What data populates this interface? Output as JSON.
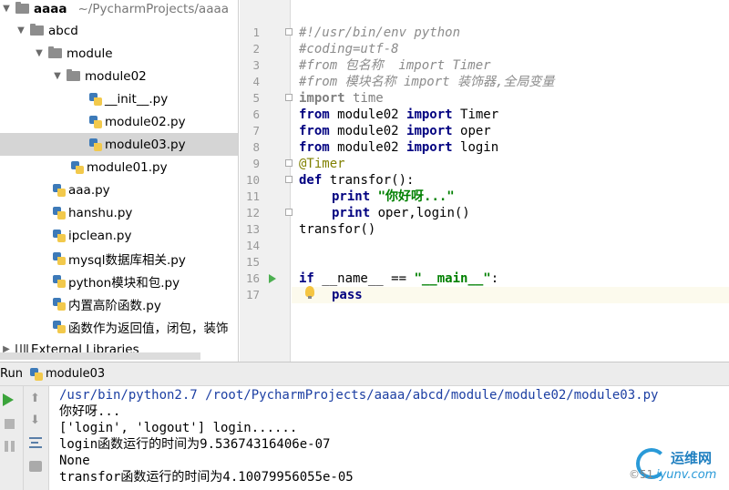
{
  "project_tree": {
    "root": {
      "name": "aaaa",
      "path": "~/PycharmProjects/aaaa"
    },
    "items": [
      {
        "label": "abcd",
        "type": "folder"
      },
      {
        "label": "module",
        "type": "folder"
      },
      {
        "label": "module02",
        "type": "folder"
      },
      {
        "label": "__init__.py",
        "type": "python-file"
      },
      {
        "label": "module02.py",
        "type": "python-file"
      },
      {
        "label": "module03.py",
        "type": "python-file"
      },
      {
        "label": "module01.py",
        "type": "python-file"
      },
      {
        "label": "aaa.py",
        "type": "python-file"
      },
      {
        "label": "hanshu.py",
        "type": "python-file"
      },
      {
        "label": "ipclean.py",
        "type": "python-file"
      },
      {
        "label": "mysql数据库相关.py",
        "type": "python-file"
      },
      {
        "label": "python模块和包.py",
        "type": "python-file"
      },
      {
        "label": "内置高阶函数.py",
        "type": "python-file"
      },
      {
        "label": "函数作为返回值，闭包，装饰",
        "type": "python-file"
      },
      {
        "label": "External Libraries",
        "type": "library"
      }
    ],
    "selected": "module03.py"
  },
  "editor": {
    "line_numbers": [
      "1",
      "2",
      "3",
      "4",
      "5",
      "6",
      "7",
      "8",
      "9",
      "10",
      "11",
      "12",
      "13",
      "14",
      "15",
      "16",
      "17"
    ],
    "line1": "#!/usr/bin/env python",
    "line2": "#coding=utf-8",
    "line3": "#from 包名称  import Timer",
    "line4": "#from 模块名称 import 装饰器,全局变量",
    "kw_import": "import",
    "kw_from": "from",
    "kw_def": "def",
    "kw_print": "print",
    "kw_if": "if",
    "kw_pass": "pass",
    "mod_time": " time",
    "mod_module02": " module02 ",
    "name_timer": " Timer",
    "name_oper": " oper",
    "name_login": " login",
    "decorator": "@Timer",
    "def_name": " transfor():",
    "print_str": " \"你好呀...\"",
    "print_args": " oper,login()",
    "call": "transfor()",
    "if_mid": " __name__ == ",
    "main_str": "\"__main__\"",
    "colon": ":"
  },
  "run_panel": {
    "label": "Run",
    "tab": "module03",
    "output": [
      "/usr/bin/python2.7 /root/PycharmProjects/aaaa/abcd/module/module02/module03.py",
      "你好呀...",
      "['login', 'logout'] login......",
      "login函数运行的时间为9.53674316406e-07",
      "None",
      "transfor函数运行的时间为4.10079956055e-05"
    ]
  },
  "watermark": {
    "cn": "运维网",
    "en": "iyunv.com",
    "left": "©51"
  },
  "colors": {
    "keyword": "#000080",
    "string": "#008000",
    "comment": "#8c8c8c",
    "decorator": "#808000",
    "selection": "#d5d5d5",
    "run_green": "#3ba43b"
  }
}
